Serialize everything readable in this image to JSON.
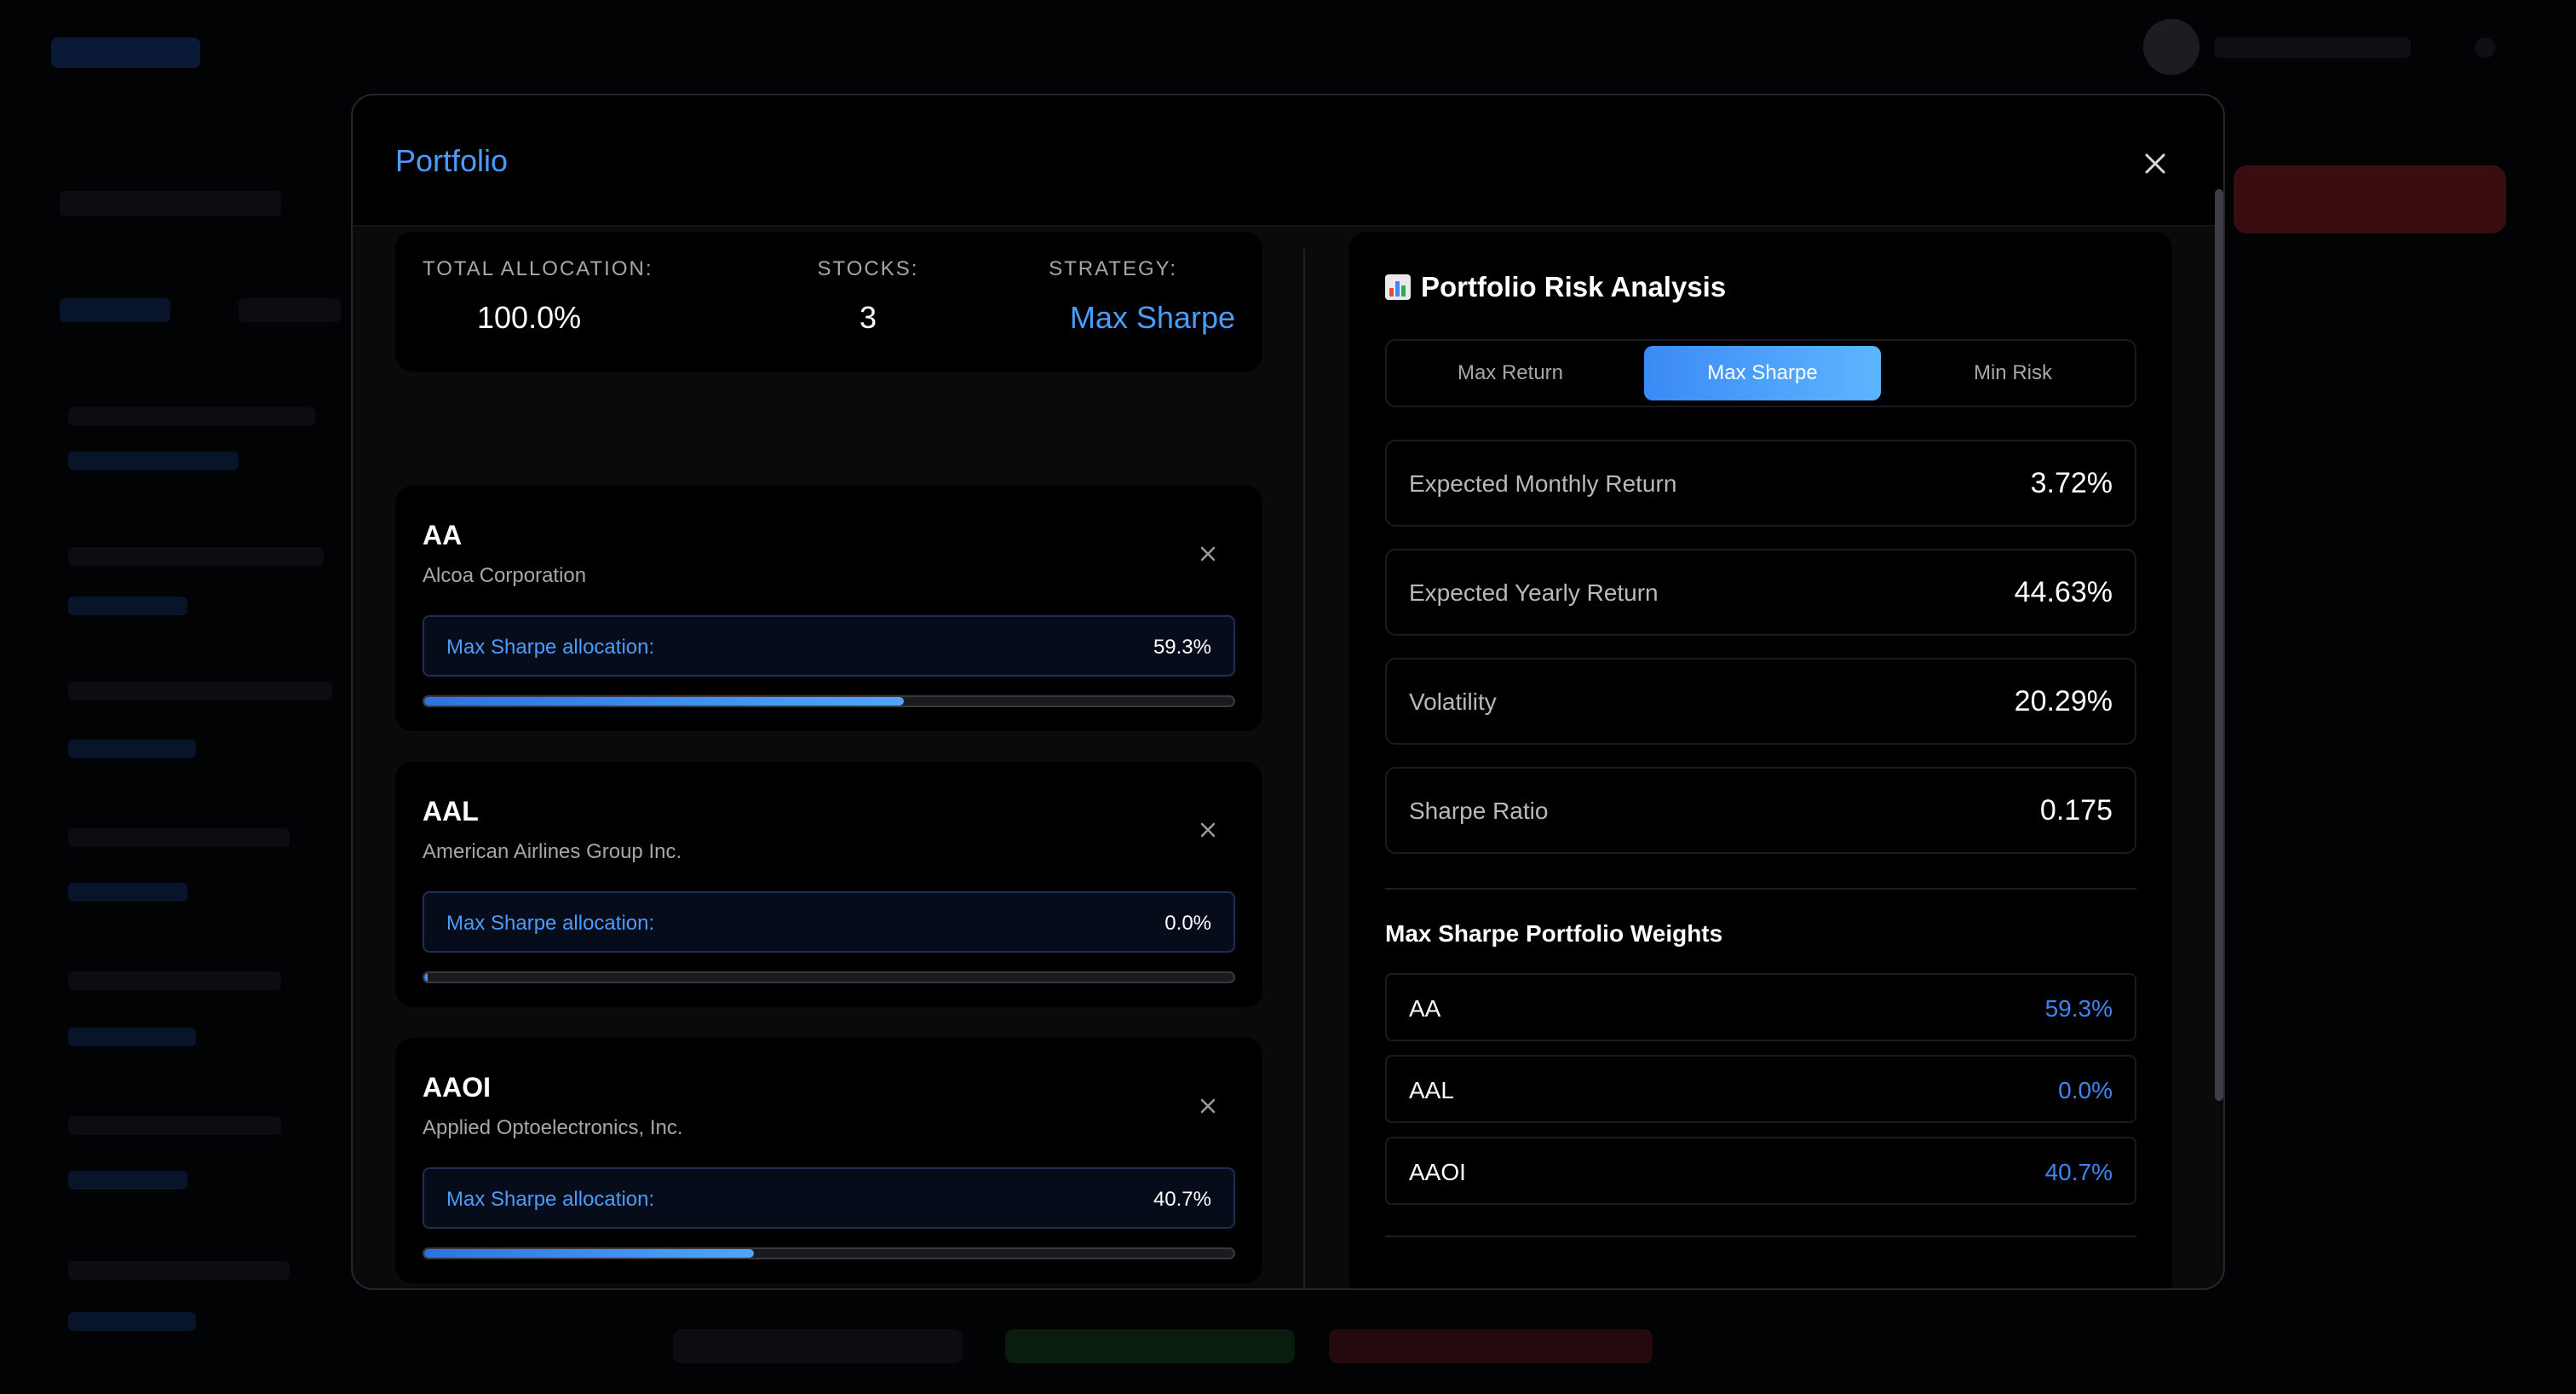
{
  "modal": {
    "title": "Portfolio"
  },
  "summary": {
    "total_allocation_label": "TOTAL ALLOCATION:",
    "total_allocation_value": "100.0%",
    "stocks_label": "STOCKS:",
    "stocks_value": "3",
    "strategy_label": "STRATEGY:",
    "strategy_value": "Max Sharpe"
  },
  "stocks": [
    {
      "ticker": "AA",
      "name": "Alcoa Corporation",
      "allocation_label": "Max Sharpe allocation:",
      "allocation_value": "59.3%",
      "allocation_fraction": 0.593
    },
    {
      "ticker": "AAL",
      "name": "American Airlines Group Inc.",
      "allocation_label": "Max Sharpe allocation:",
      "allocation_value": "0.0%",
      "allocation_fraction": 0.0
    },
    {
      "ticker": "AAOI",
      "name": "Applied Optoelectronics, Inc.",
      "allocation_label": "Max Sharpe allocation:",
      "allocation_value": "40.7%",
      "allocation_fraction": 0.407
    }
  ],
  "risk_analysis": {
    "title": "Portfolio Risk Analysis",
    "icon": "bar-chart-icon",
    "tabs": [
      {
        "label": "Max Return"
      },
      {
        "label": "Max Sharpe"
      },
      {
        "label": "Min Risk"
      }
    ],
    "active_tab": "Max Sharpe",
    "metrics": [
      {
        "label": "Expected Monthly Return",
        "value": "3.72%"
      },
      {
        "label": "Expected Yearly Return",
        "value": "44.63%"
      },
      {
        "label": "Volatility",
        "value": "20.29%"
      },
      {
        "label": "Sharpe Ratio",
        "value": "0.175"
      }
    ],
    "weights_title": "Max Sharpe Portfolio Weights",
    "weights": [
      {
        "ticker": "AA",
        "value": "59.3%"
      },
      {
        "ticker": "AAL",
        "value": "0.0%"
      },
      {
        "ticker": "AAOI",
        "value": "40.7%"
      }
    ]
  },
  "colors": {
    "accent": "#4a9dff",
    "background": "#000000",
    "panel": "#0a0a0b"
  }
}
